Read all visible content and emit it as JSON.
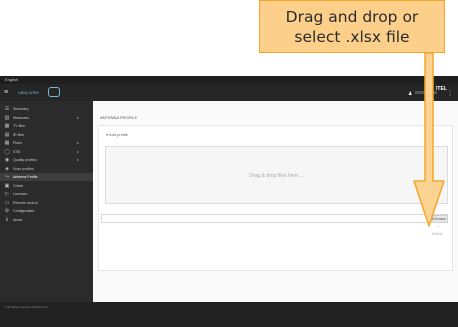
{
  "callout": {
    "line1": "Drag and drop or",
    "line2": "select .xlsx file"
  },
  "topbar": {
    "text": "English"
  },
  "header": {
    "brand": "UBIQ WISE",
    "brand_tail": "ITEL",
    "user_icon": "user-icon",
    "menu_icon": "kebab-icon"
  },
  "sidebar": {
    "items": [
      {
        "label": "Summary",
        "icon": "list-icon",
        "glyph": "☰",
        "chevron": ""
      },
      {
        "label": "Measures",
        "icon": "chart-icon",
        "glyph": "▥",
        "chevron": "▸"
      },
      {
        "label": "TV files",
        "icon": "table-icon",
        "glyph": "▦",
        "chevron": ""
      },
      {
        "label": "IR files",
        "icon": "table-icon",
        "glyph": "▤",
        "chevron": ""
      },
      {
        "label": "Plans",
        "icon": "grid-icon",
        "glyph": "▦",
        "chevron": "▸"
      },
      {
        "label": "STB",
        "icon": "box-icon",
        "glyph": "◯",
        "chevron": "▸"
      },
      {
        "label": "Quality profiles",
        "icon": "badge-icon",
        "glyph": "◉",
        "chevron": "▸"
      },
      {
        "label": "Scan profiles",
        "icon": "scan-icon",
        "glyph": "◈",
        "chevron": ""
      },
      {
        "label": "Antenna Profile",
        "icon": "antenna-icon",
        "glyph": "↪",
        "chevron": ""
      },
      {
        "label": "Check",
        "icon": "check-icon",
        "glyph": "▣",
        "chevron": ""
      },
      {
        "label": "Licenses",
        "icon": "license-icon",
        "glyph": "▷",
        "chevron": ""
      },
      {
        "label": "Remote control",
        "icon": "remote-icon",
        "glyph": "▭",
        "chevron": ""
      },
      {
        "label": "Configuration",
        "icon": "gear-icon",
        "glyph": "⚙",
        "chevron": ""
      },
      {
        "label": "About",
        "icon": "info-icon",
        "glyph": "ℹ",
        "chevron": ""
      }
    ],
    "active_index": 8
  },
  "main": {
    "page_title": "ANTENNA PROFILE",
    "add_profile": "Add profile",
    "dropzone_text": "Drag & drop files here ...",
    "browse_label": "Browse ...",
    "submit_label": "Submit"
  },
  "footer": {
    "text": "© All rights reserved. Sefram S.L."
  },
  "colors": {
    "callout_fill": "#fcd08a",
    "callout_border": "#f3a72d",
    "arrow": "#f3a72d",
    "sidebar_bg": "#2b2b2b",
    "content_bg": "#fafafa"
  }
}
